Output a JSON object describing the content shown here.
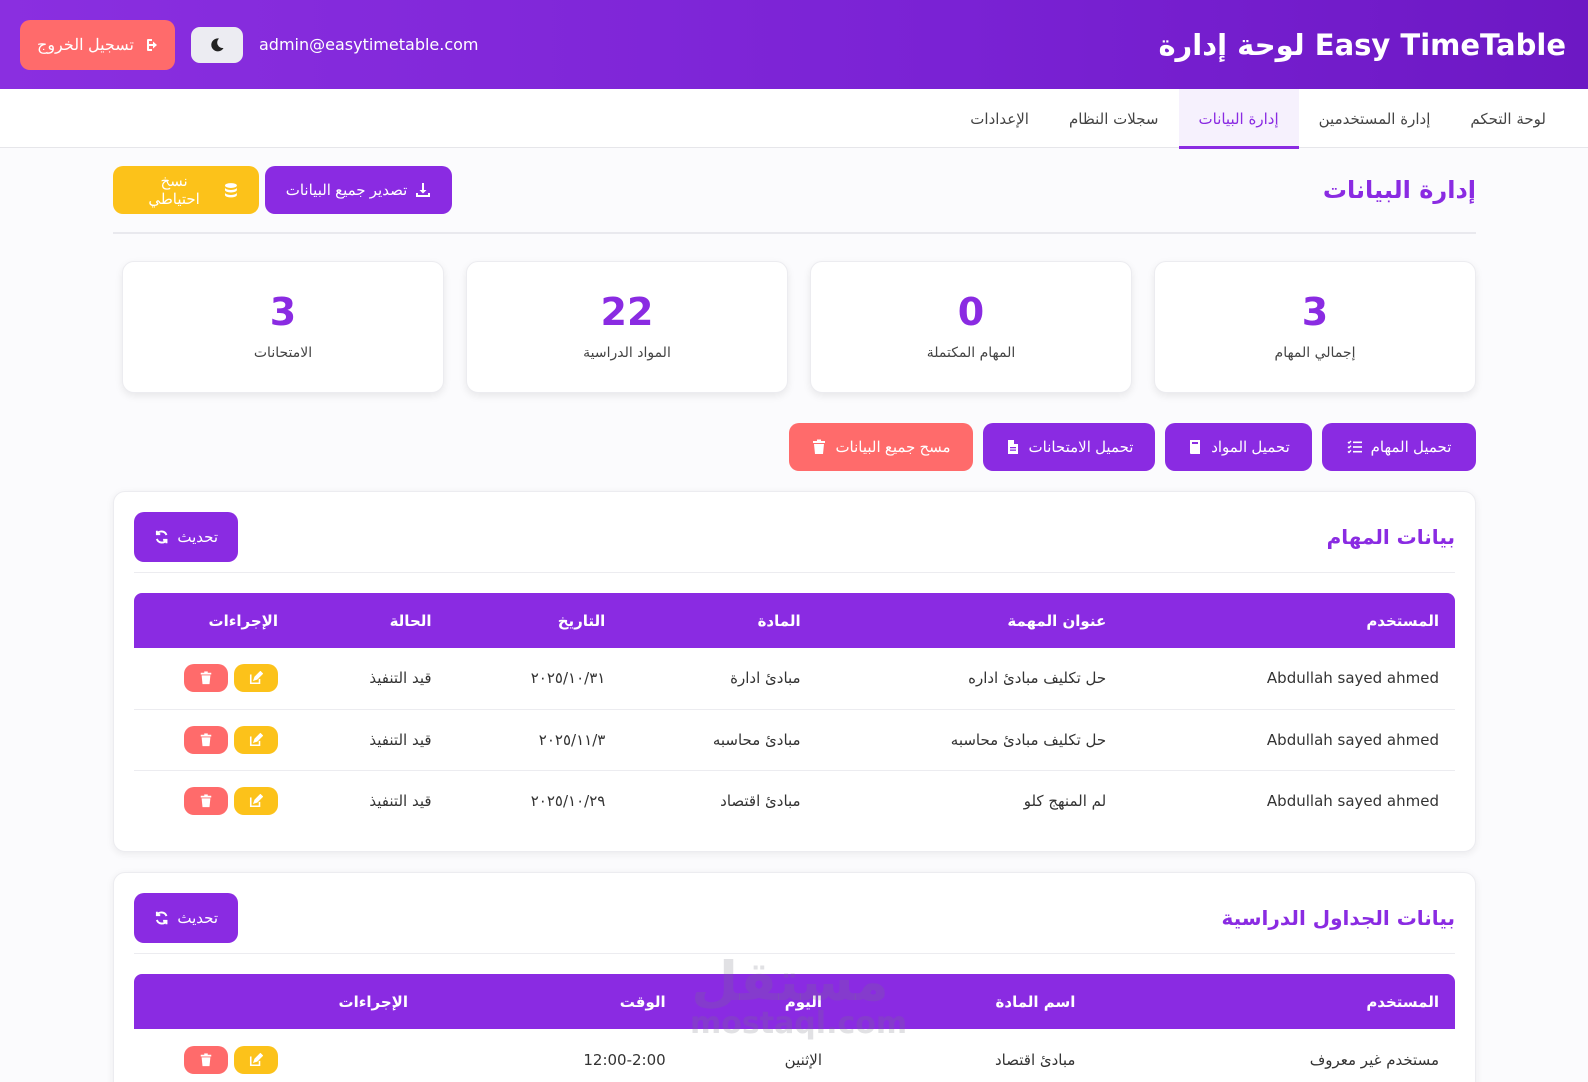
{
  "header": {
    "title": "لوحة إدارة Easy TimeTable",
    "email": "admin@easytimetable.com",
    "logout_label": "تسجيل الخروج"
  },
  "nav": {
    "tabs": [
      {
        "label": "لوحة التحكم"
      },
      {
        "label": "إدارة المستخدمين"
      },
      {
        "label": "إدارة البيانات"
      },
      {
        "label": "سجلات النظام"
      },
      {
        "label": "الإعدادات"
      }
    ],
    "active": 2
  },
  "page": {
    "title": "إدارة البيانات",
    "export_label": "تصدير جميع البيانات",
    "backup_label": "نسخ احتياطي"
  },
  "stats": [
    {
      "value": "3",
      "label": "إجمالي المهام"
    },
    {
      "value": "0",
      "label": "المهام المكتملة"
    },
    {
      "value": "22",
      "label": "المواد الدراسية"
    },
    {
      "value": "3",
      "label": "الامتحانات"
    }
  ],
  "load_actions": {
    "tasks": "تحميل المهام",
    "subjects": "تحميل المواد",
    "exams": "تحميل الامتحانات",
    "clear": "مسح جميع البيانات"
  },
  "tasks_card": {
    "title": "بيانات المهام",
    "refresh_label": "تحديث",
    "columns": [
      "المستخدم",
      "عنوان المهمة",
      "المادة",
      "التاريخ",
      "الحالة",
      "الإجراءات"
    ],
    "rows": [
      {
        "user": "Abdullah sayed ahmed",
        "task": "حل تكليف مبادئ اداره",
        "subject": "مبادئ ادارة",
        "date": "٢٠٢٥/١٠/٣١",
        "status": "قيد التنفيذ"
      },
      {
        "user": "Abdullah sayed ahmed",
        "task": "حل تكليف مبادئ محاسبه",
        "subject": "مبادئ محاسبه",
        "date": "٢٠٢٥/١١/٣",
        "status": "قيد التنفيذ"
      },
      {
        "user": "Abdullah sayed ahmed",
        "task": "لم المنهج كلو",
        "subject": "مبادئ اقتصاد",
        "date": "٢٠٢٥/١٠/٢٩",
        "status": "قيد التنفيذ"
      }
    ]
  },
  "schedule_card": {
    "title": "بيانات الجداول الدراسية",
    "refresh_label": "تحديث",
    "columns": [
      "المستخدم",
      "اسم المادة",
      "اليوم",
      "الوقت",
      "الإجراءات"
    ],
    "rows": [
      {
        "user": "مستخدم غير معروف",
        "subject": "مبادئ اقتصاد",
        "day": "الإثنين",
        "time": "12:00-2:00"
      }
    ]
  },
  "watermark": {
    "arabic": "مستقل",
    "latin": "mostaql.com"
  },
  "colors": {
    "primary": "#8a2be2",
    "danger": "#ff6b6b",
    "warning": "#fcc21a"
  }
}
